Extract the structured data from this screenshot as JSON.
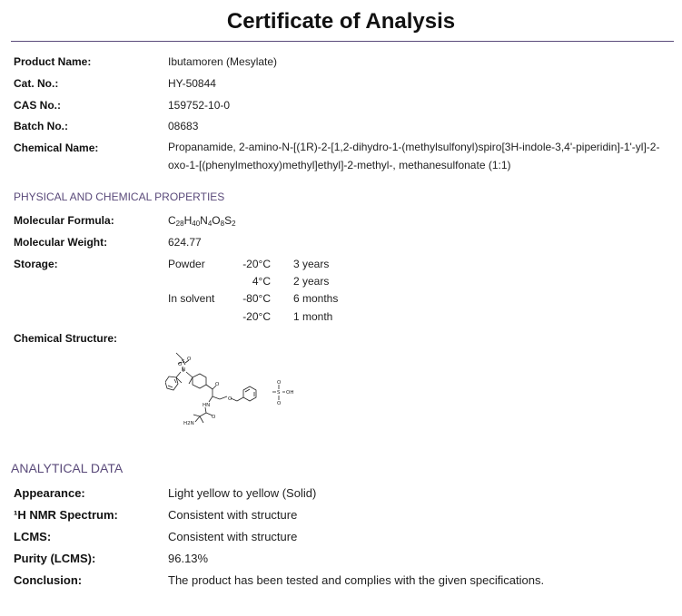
{
  "title": "Certificate of Analysis",
  "product": {
    "product_name_label": "Product Name:",
    "product_name": "Ibutamoren (Mesylate)",
    "cat_no_label": "Cat. No.:",
    "cat_no": "HY-50844",
    "cas_no_label": "CAS No.:",
    "cas_no": "159752-10-0",
    "batch_no_label": "Batch No.:",
    "batch_no": "08683",
    "chemical_name_label": "Chemical Name:",
    "chemical_name": "Propanamide, 2-amino-N-[(1R)-2-[1,2-dihydro-1-(methylsulfonyl)spiro[3H-indole-3,4'-piperidin]-1'-yl]-2-oxo-1-[(phenylmethoxy)methyl]ethyl]-2-methyl-, methanesulfonate (1:1)"
  },
  "physical": {
    "section_title": "PHYSICAL AND CHEMICAL PROPERTIES",
    "formula_label": "Molecular Formula:",
    "formula": {
      "c": "C",
      "c_n": "28",
      "h": "H",
      "h_n": "40",
      "n": "N",
      "n_n": "4",
      "o": "O",
      "o_n": "8",
      "s": "S",
      "s_n": "2"
    },
    "weight_label": "Molecular Weight:",
    "weight": "624.77",
    "storage_label": "Storage:",
    "storage": [
      {
        "form": "Powder",
        "temp": "-20°C",
        "duration": "3 years"
      },
      {
        "form": "",
        "temp": "4°C",
        "duration": "2 years"
      },
      {
        "form": "In solvent",
        "temp": "-80°C",
        "duration": "6 months"
      },
      {
        "form": "",
        "temp": "-20°C",
        "duration": "1 month"
      }
    ],
    "structure_label": "Chemical Structure:",
    "structure_atoms": {
      "o1": "O",
      "s1": "S",
      "o2": "O",
      "n1": "N",
      "o3": "O",
      "o4": "O",
      "hn": "HN",
      "o5": "O",
      "h2n": "H2N",
      "o6": "O",
      "s2": "S",
      "oh": "OH",
      "o7": "O"
    }
  },
  "analytical": {
    "section_title": "ANALYTICAL DATA",
    "appearance_label": "Appearance:",
    "appearance": "Light yellow to yellow (Solid)",
    "nmr_label": "¹H NMR Spectrum:",
    "nmr": "Consistent with structure",
    "lcms_label": "LCMS:",
    "lcms": "Consistent with structure",
    "purity_label": "Purity (LCMS):",
    "purity": "96.13%",
    "conclusion_label": "Conclusion:",
    "conclusion": "The product has been tested and complies with the given specifications."
  }
}
